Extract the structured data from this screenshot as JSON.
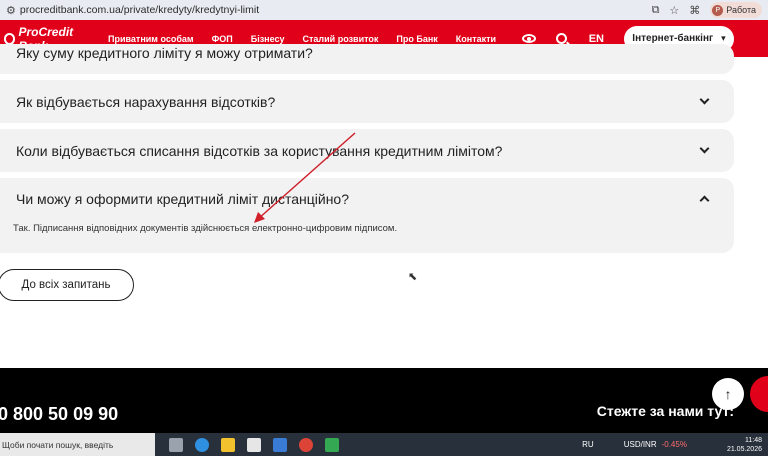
{
  "browser": {
    "url": "procreditbank.com.ua/private/kredyty/kredytnyi-limit",
    "profile_label": "Работа",
    "profile_initial": "Р"
  },
  "nav": {
    "logo_text": "ProCredit Bank",
    "items": [
      "Приватним особам",
      "ФОП",
      "Бізнесу",
      "Сталий розвиток",
      "Про Банк",
      "Контакти"
    ],
    "lang": "EN",
    "ib_button": "Інтернет-банкінг"
  },
  "faq": {
    "cut_question": "Яку суму кредитного ліміту я можу отримати?",
    "items": [
      {
        "question": "Як відбувається нарахування відсотків?"
      },
      {
        "question": "Коли відбувається списання відсотків за користування кредитним лімітом?"
      },
      {
        "question": "Чи можу я оформити кредитний ліміт дистанційно?",
        "answer": "Так. Підписання відповідних документів здійснюється електронно-цифровим підписом."
      }
    ],
    "all_button": "До всіх запитань"
  },
  "footer": {
    "phone": "0 800 50 09 90",
    "follow": "Стежте за нами тут:"
  },
  "taskbar": {
    "search_placeholder": "Щоби почати пошук, введіть",
    "lang": "RU",
    "currency": "USD/INR",
    "currency_change": "-0.45%",
    "time": "11:48",
    "date": "21.05.2026"
  },
  "colors": {
    "brand_red": "#e1001a",
    "faq_bg": "#f2f2f2",
    "footer_bg": "#000000"
  }
}
